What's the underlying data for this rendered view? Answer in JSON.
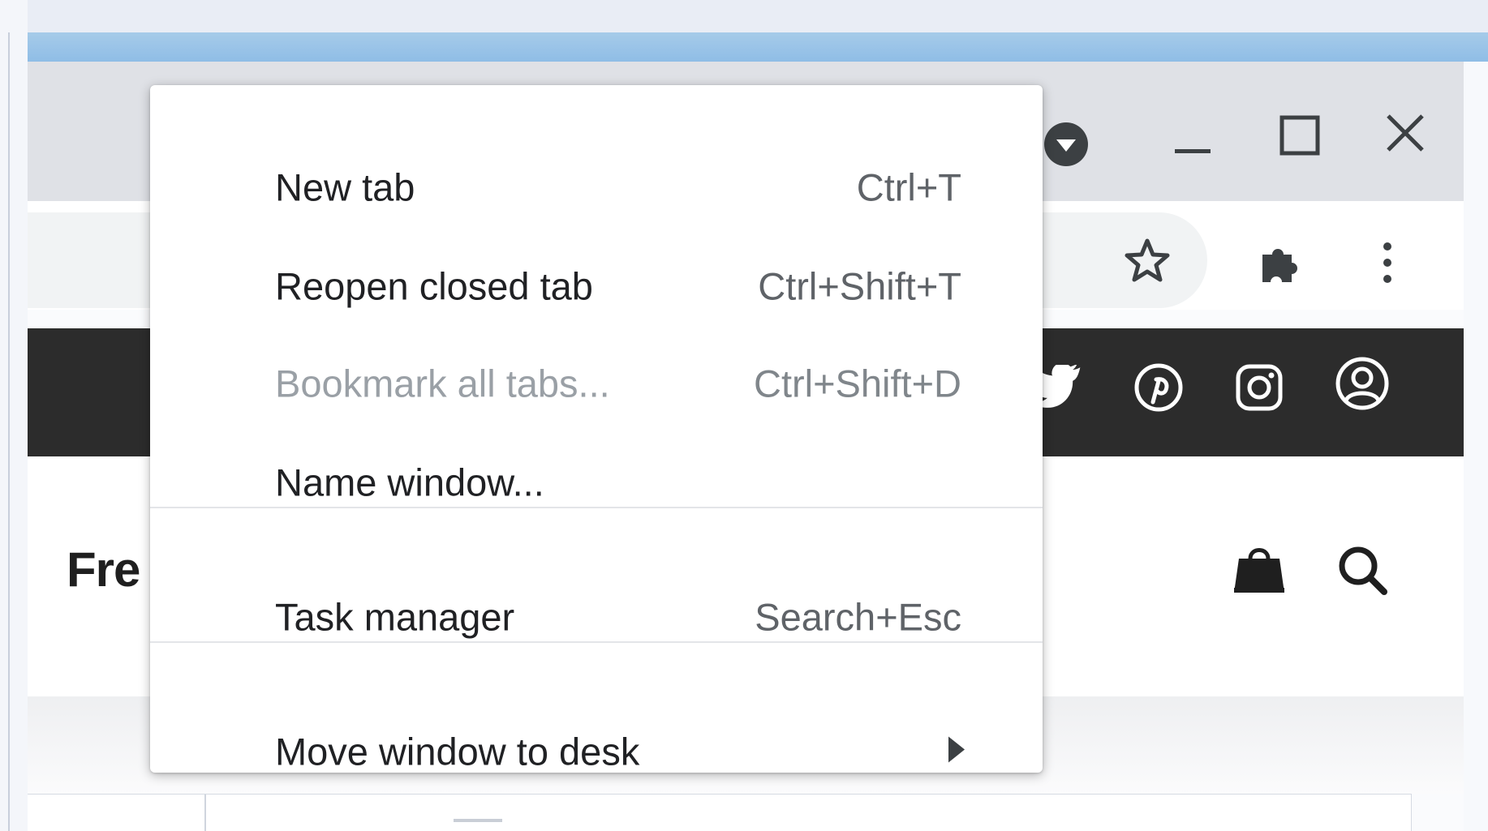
{
  "site": {
    "logo_text": "Fre"
  },
  "window_controls": {
    "minimize_icon": "minimize-icon",
    "maximize_icon": "maximize-icon",
    "close_icon": "close-icon"
  },
  "context_menu": {
    "items": [
      {
        "label": "New tab",
        "shortcut": "Ctrl+T",
        "enabled": true
      },
      {
        "label": "Reopen closed tab",
        "shortcut": "Ctrl+Shift+T",
        "enabled": true
      },
      {
        "label": "Bookmark all tabs...",
        "shortcut": "Ctrl+Shift+D",
        "enabled": false
      },
      {
        "label": "Name window...",
        "shortcut": "",
        "enabled": true
      },
      {
        "label": "Task manager",
        "shortcut": "Search+Esc",
        "enabled": true
      },
      {
        "label": "Move window to desk",
        "shortcut": "",
        "enabled": true,
        "submenu": true
      }
    ]
  },
  "colors": {
    "titlebar": "#dfe1e6",
    "site_nav": "#2c2c2c",
    "accent_blue": "#8fbde6"
  }
}
